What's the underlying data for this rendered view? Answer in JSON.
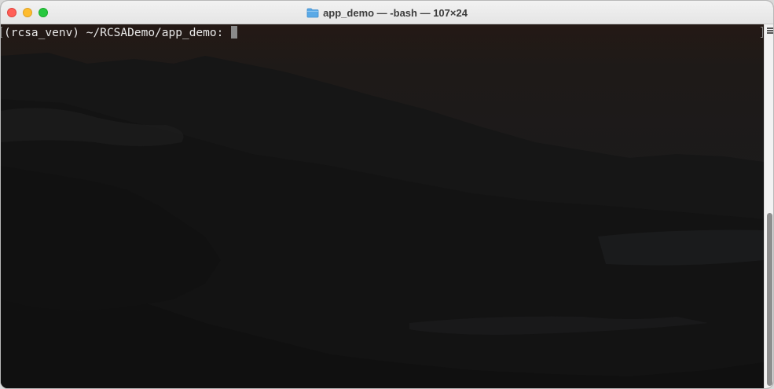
{
  "window": {
    "title": "app_demo — -bash — 107×24",
    "folder_icon": "folder-icon"
  },
  "terminal": {
    "prompt": "(rcsa_venv) ~/RCSADemo/app_demo: ",
    "background_theme": "dusk mountain coastline"
  },
  "colors": {
    "close": "#ff5f57",
    "minimize": "#febc2e",
    "maximize": "#28c840",
    "prompt_text": "#e8e8e8",
    "cursor": "#8a8a8a"
  },
  "scrollbar": {
    "menu_icon": "hamburger-menu-icon"
  }
}
